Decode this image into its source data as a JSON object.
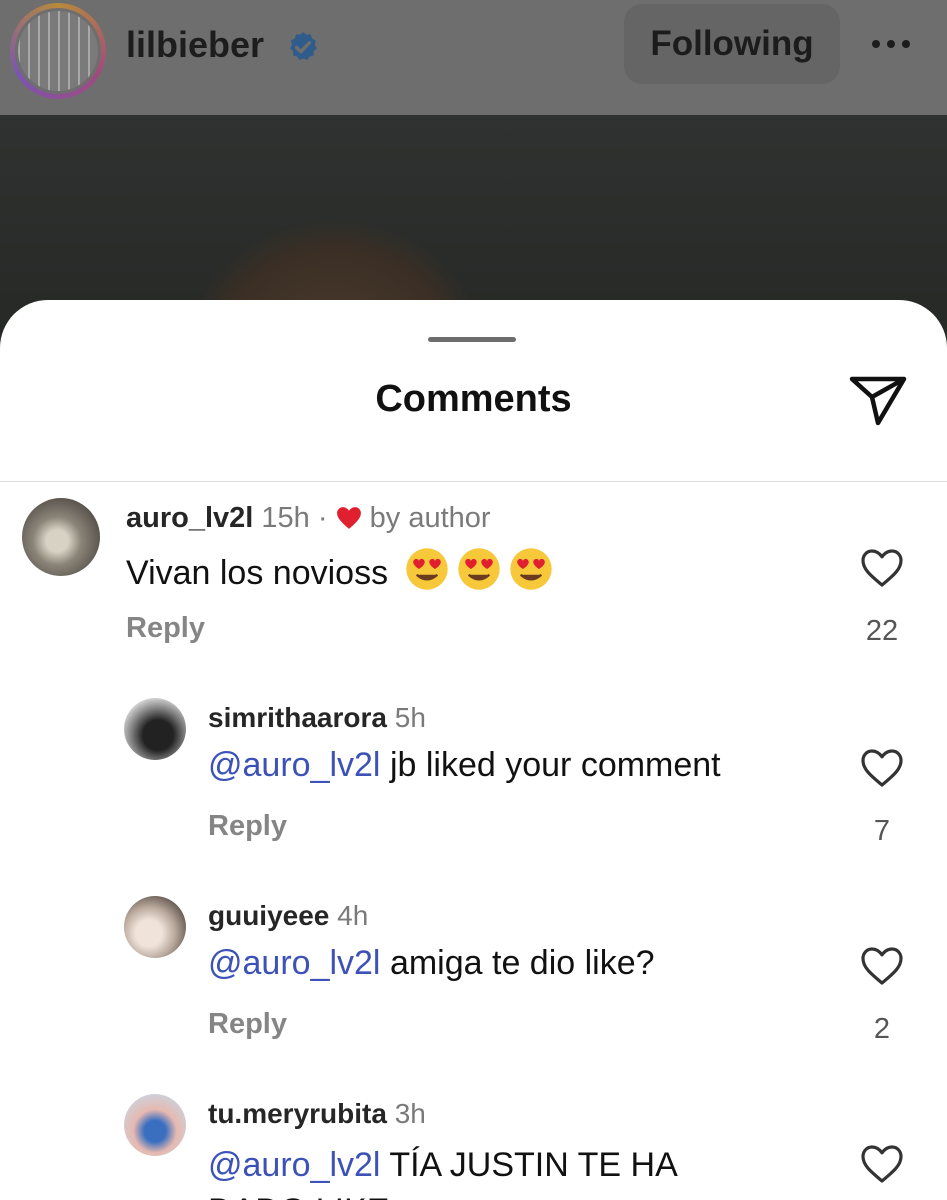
{
  "header": {
    "username": "lilbieber",
    "following_label": "Following"
  },
  "sheet": {
    "title": "Comments"
  },
  "comments": [
    {
      "username": "auro_lv2l",
      "time": "15h",
      "separator": "·",
      "badge": "by author",
      "text": "Vivan los novioss",
      "emoji_count": 3,
      "reply_label": "Reply",
      "likes": "22"
    },
    {
      "username": "simrithaarora",
      "time": "5h",
      "mention": "@auro_lv2l",
      "text": " jb liked your comment",
      "reply_label": "Reply",
      "likes": "7"
    },
    {
      "username": "guuiyeee",
      "time": "4h",
      "mention": "@auro_lv2l",
      "text": " amiga te dio like?",
      "reply_label": "Reply",
      "likes": "2"
    },
    {
      "username": "tu.meryrubita",
      "time": "3h",
      "mention": "@auro_lv2l",
      "text": " TÍA JUSTIN TE HA",
      "text2": "DADO LIKE"
    }
  ],
  "icons": {
    "verified": "verified-badge-icon",
    "more": "more-options-icon",
    "share": "send-icon",
    "like": "heart-outline-icon",
    "author_like": "heart-filled-icon"
  },
  "colors": {
    "verified": "#3897f0",
    "heart": "#e0202e",
    "mention": "#3c52b8"
  }
}
